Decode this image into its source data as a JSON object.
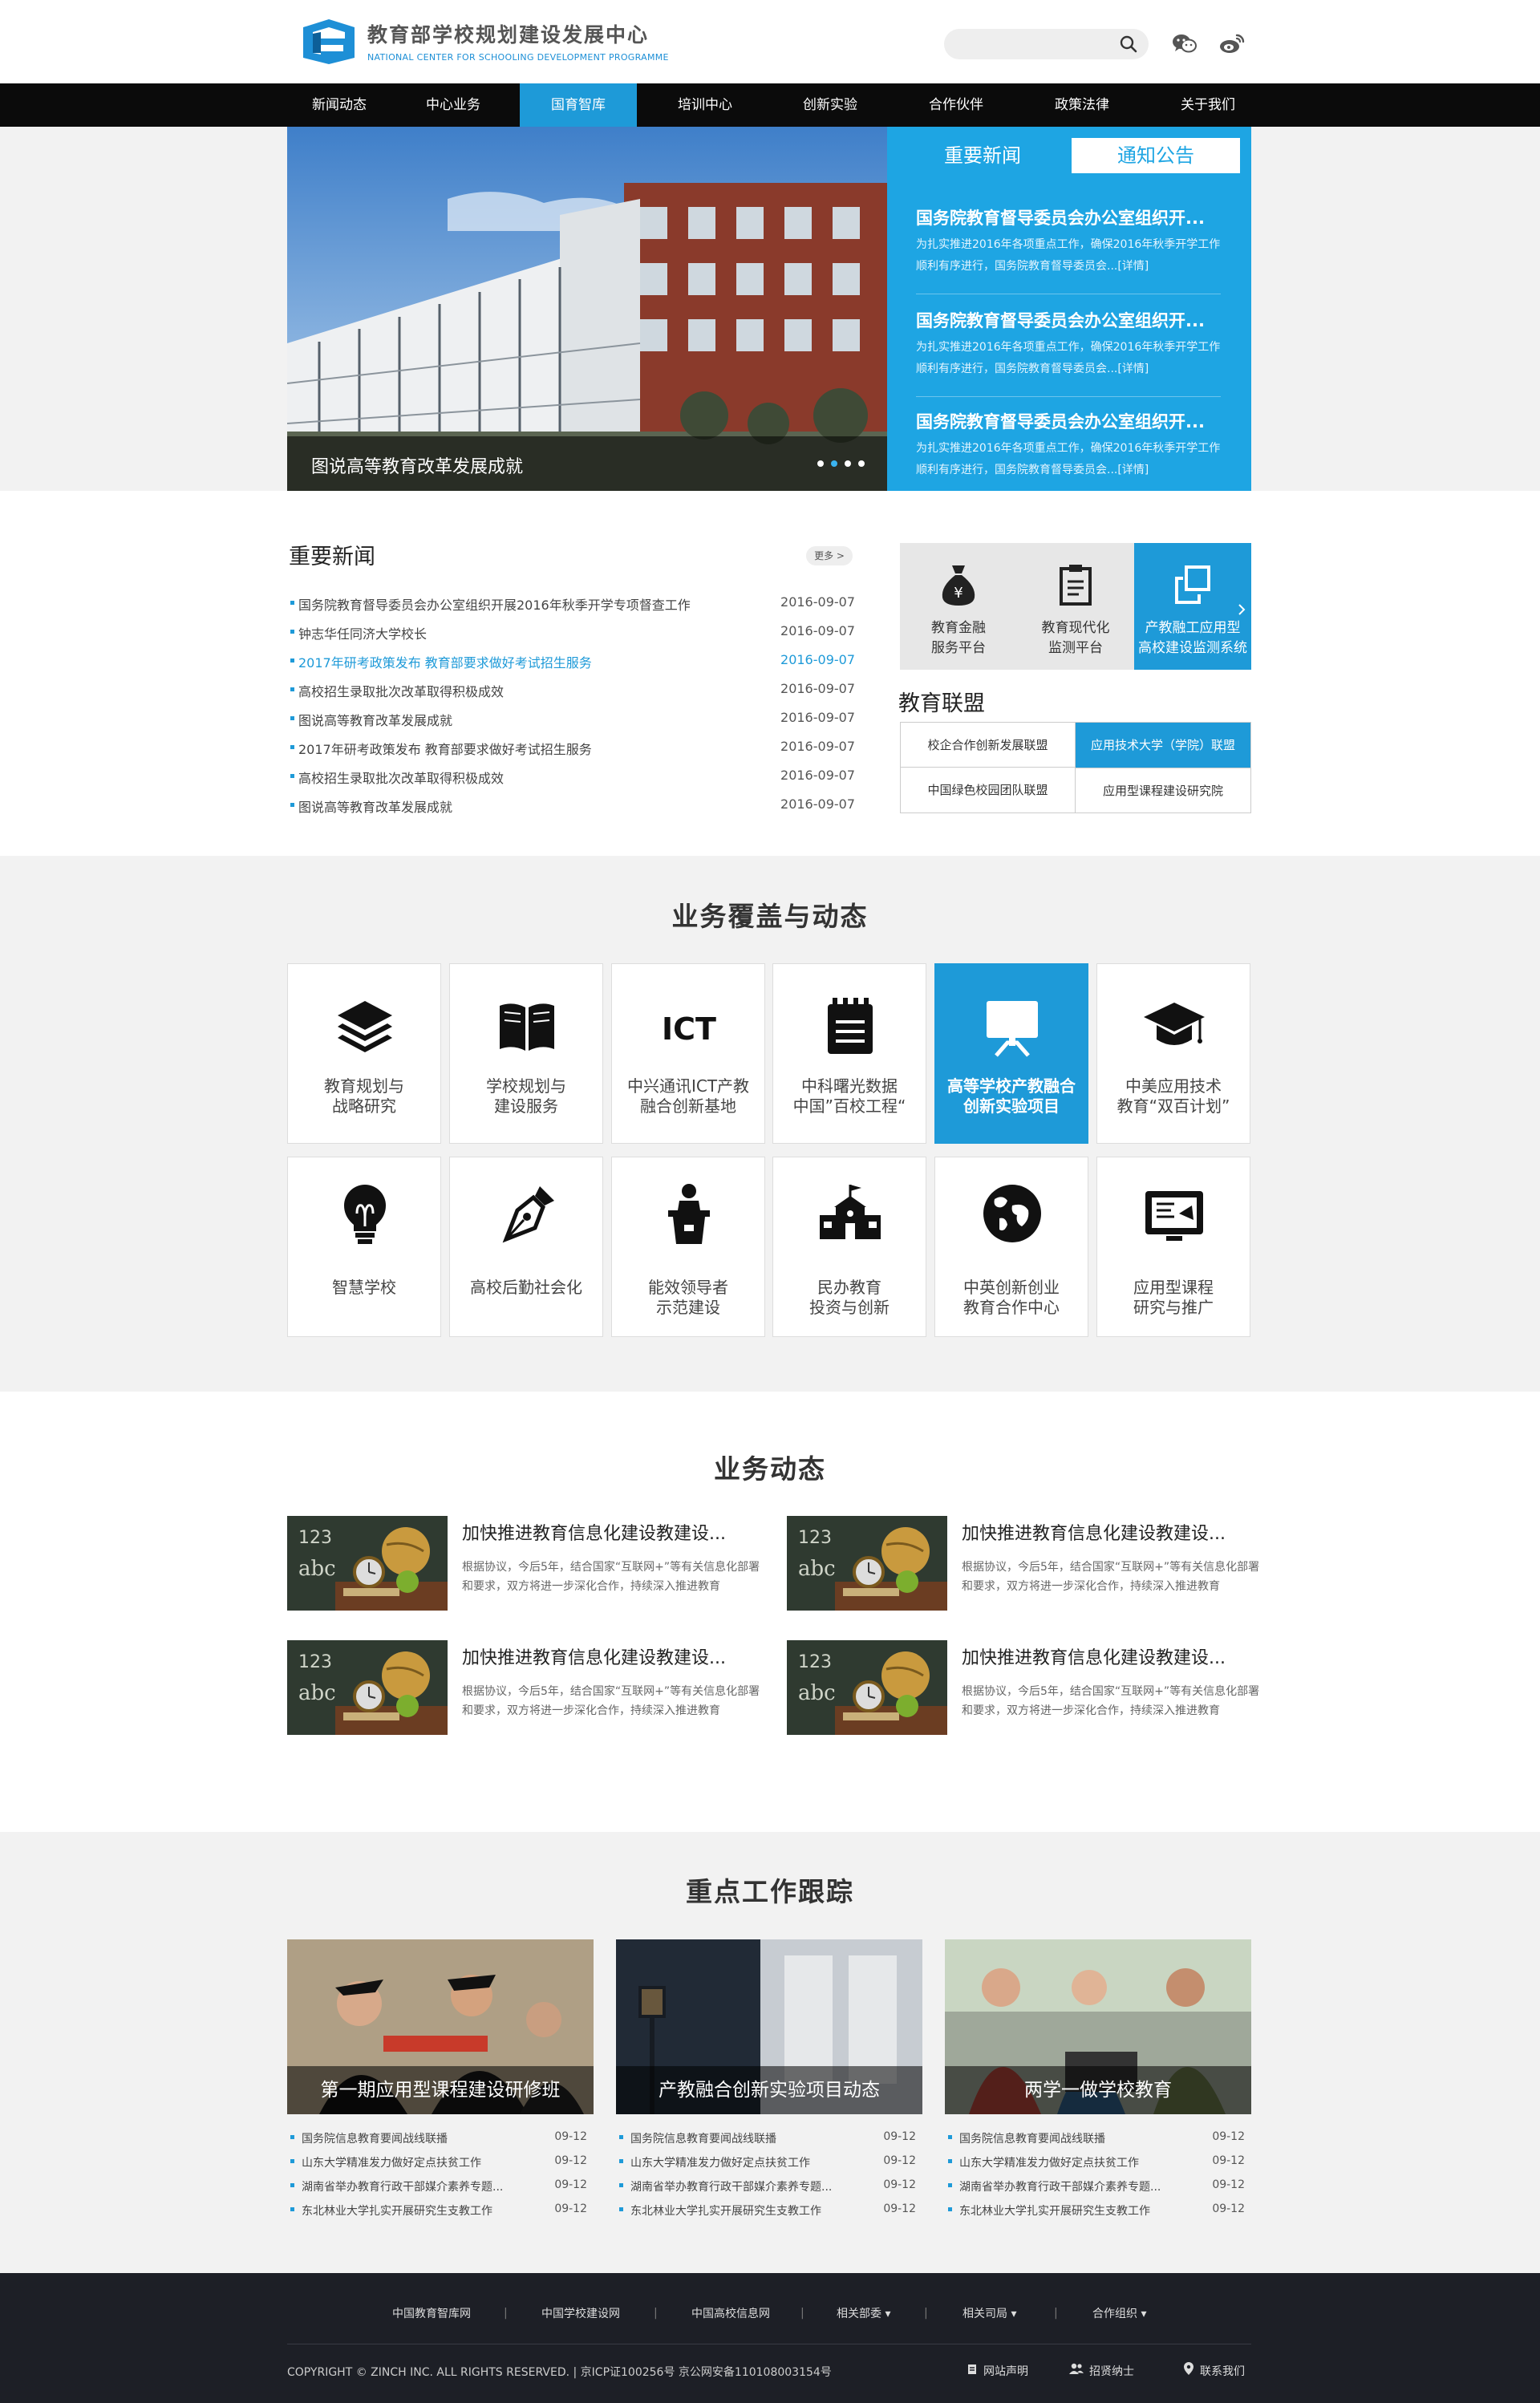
{
  "header": {
    "logo_cn": "教育部学校规划建设发展中心",
    "logo_en": "NATIONAL CENTER FOR SCHOOLING DEVELOPMENT PROGRAMME",
    "search_placeholder": ""
  },
  "nav": [
    "新闻动态",
    "中心业务",
    "国育智库",
    "培训中心",
    "创新实验",
    "合作伙伴",
    "政策法律",
    "关于我们"
  ],
  "nav_active": "国育智库",
  "hero": {
    "caption": "图说高等教育改革发展成就",
    "tabs": [
      "重要新闻",
      "通知公告"
    ],
    "items": [
      {
        "title": "国务院教育督导委员会办公室组织开...",
        "desc": "为扎实推进2016年各项重点工作，确保2016年秋季开学工作顺利有序进行，国务院教育督导委员会...[详情]"
      },
      {
        "title": "国务院教育督导委员会办公室组织开...",
        "desc": "为扎实推进2016年各项重点工作，确保2016年秋季开学工作顺利有序进行，国务院教育督导委员会...[详情]"
      },
      {
        "title": "国务院教育督导委员会办公室组织开...",
        "desc": "为扎实推进2016年各项重点工作，确保2016年秋季开学工作顺利有序进行，国务院教育督导委员会...[详情]"
      }
    ]
  },
  "news": {
    "title": "重要新闻",
    "more": "更多 >",
    "items": [
      {
        "title": "国务院教育督导委员会办公室组织开展2016年秋季开学专项督查工作",
        "date": "2016-09-07"
      },
      {
        "title": "钟志华任同济大学校长",
        "date": "2016-09-07"
      },
      {
        "title": "2017年研考政策发布 教育部要求做好考试招生服务",
        "date": "2016-09-07"
      },
      {
        "title": "高校招生录取批次改革取得积极成效",
        "date": "2016-09-07"
      },
      {
        "title": "图说高等教育改革发展成就",
        "date": "2016-09-07"
      },
      {
        "title": "2017年研考政策发布 教育部要求做好考试招生服务",
        "date": "2016-09-07"
      },
      {
        "title": "高校招生录取批次改革取得积极成效",
        "date": "2016-09-07"
      },
      {
        "title": "图说高等教育改革发展成就",
        "date": "2016-09-07"
      }
    ]
  },
  "platforms": [
    {
      "line1": "教育金融",
      "line2": "服务平台"
    },
    {
      "line1": "教育现代化",
      "line2": "监测平台"
    },
    {
      "line1": "产教融工应用型",
      "line2": "高校建设监测系统"
    }
  ],
  "alliance": {
    "title": "教育联盟",
    "cells": [
      "校企合作创新发展联盟",
      "应用技术大学（学院）联盟",
      "中国绿色校园团队联盟",
      "应用型课程建设研究院"
    ]
  },
  "services": {
    "title": "业务覆盖与动态",
    "items": [
      {
        "label": "教育规划与\n战略研究",
        "icon": "layers-icon"
      },
      {
        "label": "学校规划与\n建设服务",
        "icon": "book-icon"
      },
      {
        "label": "中兴通讯ICT产教\n融合创新基地",
        "icon": "ict-icon"
      },
      {
        "label": "中科曙光数据\n中国”百校工程“",
        "icon": "notepad-icon"
      },
      {
        "label": "高等学校产教融合\n创新实验项目",
        "icon": "presentation-board-icon"
      },
      {
        "label": "中美应用技术\n教育“双百计划”",
        "icon": "graduation-cap-icon"
      },
      {
        "label": "智慧学校",
        "icon": "lightbulb-icon"
      },
      {
        "label": "高校后勤社会化",
        "icon": "pen-nib-icon"
      },
      {
        "label": "能效领导者\n示范建设",
        "icon": "speaker-podium-icon"
      },
      {
        "label": "民办教育\n投资与创新",
        "icon": "school-building-icon"
      },
      {
        "label": "中英创新创业\n教育合作中心",
        "icon": "globe-icon"
      },
      {
        "label": "应用型课程\n研究与推广",
        "icon": "tablet-icon"
      }
    ]
  },
  "dynamics": {
    "title": "业务动态",
    "items": [
      {
        "title": "加快推进教育信息化建设教建设...",
        "desc": "根据协议，今后5年，结合国家“互联网+”等有关信息化部署和要求，双方将进一步深化合作，持续深入推进教育"
      },
      {
        "title": "加快推进教育信息化建设教建设...",
        "desc": "根据协议，今后5年，结合国家“互联网+”等有关信息化部署和要求，双方将进一步深化合作，持续深入推进教育"
      },
      {
        "title": "加快推进教育信息化建设教建设...",
        "desc": "根据协议，今后5年，结合国家“互联网+”等有关信息化部署和要求，双方将进一步深化合作，持续深入推进教育"
      },
      {
        "title": "加快推进教育信息化建设教建设...",
        "desc": "根据协议，今后5年，结合国家“互联网+”等有关信息化部署和要求，双方将进一步深化合作，持续深入推进教育"
      }
    ]
  },
  "tracking": {
    "title": "重点工作跟踪",
    "columns": [
      {
        "caption": "第一期应用型课程建设研修班",
        "rows": [
          {
            "title": "国务院信息教育要闻战线联播",
            "date": "09-12"
          },
          {
            "title": "山东大学精准发力做好定点扶贫工作",
            "date": "09-12"
          },
          {
            "title": "湖南省举办教育行政干部媒介素养专题...",
            "date": "09-12"
          },
          {
            "title": "东北林业大学扎实开展研究生支教工作",
            "date": "09-12"
          }
        ]
      },
      {
        "caption": "产教融合创新实验项目动态",
        "rows": [
          {
            "title": "国务院信息教育要闻战线联播",
            "date": "09-12"
          },
          {
            "title": "山东大学精准发力做好定点扶贫工作",
            "date": "09-12"
          },
          {
            "title": "湖南省举办教育行政干部媒介素养专题...",
            "date": "09-12"
          },
          {
            "title": "东北林业大学扎实开展研究生支教工作",
            "date": "09-12"
          }
        ]
      },
      {
        "caption": "两学一做学校教育",
        "rows": [
          {
            "title": "国务院信息教育要闻战线联播",
            "date": "09-12"
          },
          {
            "title": "山东大学精准发力做好定点扶贫工作",
            "date": "09-12"
          },
          {
            "title": "湖南省举办教育行政干部媒介素养专题...",
            "date": "09-12"
          },
          {
            "title": "东北林业大学扎实开展研究生支教工作",
            "date": "09-12"
          }
        ]
      }
    ]
  },
  "footer": {
    "links": [
      "中国教育智库网",
      "中国学校建设网",
      "中国高校信息网",
      "相关部委 ▾",
      "相关司局 ▾",
      "合作组织 ▾"
    ],
    "copyright": "COPYRIGHT © ZINCH INC. ALL RIGHTS RESERVED. | 京ICP证100256号 京公网安备110108003154号",
    "right_links": [
      "网站声明",
      "招贤纳士",
      "联系我们"
    ]
  },
  "colors": {
    "accent": "#1e9ad8",
    "nav_bg": "#0b0b0b",
    "footer_bg": "#1d1f26"
  }
}
